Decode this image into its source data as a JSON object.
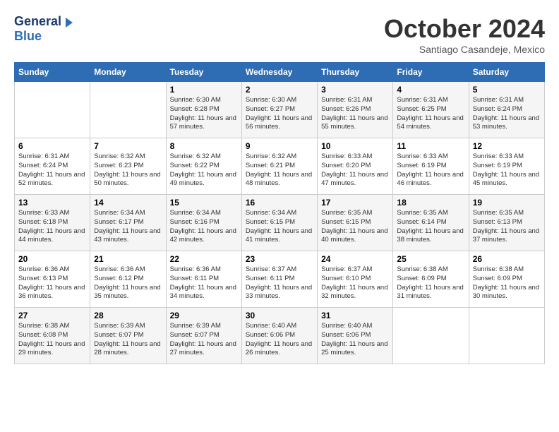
{
  "header": {
    "logo_general": "General",
    "logo_blue": "Blue",
    "month_title": "October 2024",
    "location": "Santiago Casandeje, Mexico"
  },
  "days_of_week": [
    "Sunday",
    "Monday",
    "Tuesday",
    "Wednesday",
    "Thursday",
    "Friday",
    "Saturday"
  ],
  "weeks": [
    [
      {
        "day": "",
        "info": ""
      },
      {
        "day": "",
        "info": ""
      },
      {
        "day": "1",
        "info": "Sunrise: 6:30 AM\nSunset: 6:28 PM\nDaylight: 11 hours and 57 minutes."
      },
      {
        "day": "2",
        "info": "Sunrise: 6:30 AM\nSunset: 6:27 PM\nDaylight: 11 hours and 56 minutes."
      },
      {
        "day": "3",
        "info": "Sunrise: 6:31 AM\nSunset: 6:26 PM\nDaylight: 11 hours and 55 minutes."
      },
      {
        "day": "4",
        "info": "Sunrise: 6:31 AM\nSunset: 6:25 PM\nDaylight: 11 hours and 54 minutes."
      },
      {
        "day": "5",
        "info": "Sunrise: 6:31 AM\nSunset: 6:24 PM\nDaylight: 11 hours and 53 minutes."
      }
    ],
    [
      {
        "day": "6",
        "info": "Sunrise: 6:31 AM\nSunset: 6:24 PM\nDaylight: 11 hours and 52 minutes."
      },
      {
        "day": "7",
        "info": "Sunrise: 6:32 AM\nSunset: 6:23 PM\nDaylight: 11 hours and 50 minutes."
      },
      {
        "day": "8",
        "info": "Sunrise: 6:32 AM\nSunset: 6:22 PM\nDaylight: 11 hours and 49 minutes."
      },
      {
        "day": "9",
        "info": "Sunrise: 6:32 AM\nSunset: 6:21 PM\nDaylight: 11 hours and 48 minutes."
      },
      {
        "day": "10",
        "info": "Sunrise: 6:33 AM\nSunset: 6:20 PM\nDaylight: 11 hours and 47 minutes."
      },
      {
        "day": "11",
        "info": "Sunrise: 6:33 AM\nSunset: 6:19 PM\nDaylight: 11 hours and 46 minutes."
      },
      {
        "day": "12",
        "info": "Sunrise: 6:33 AM\nSunset: 6:19 PM\nDaylight: 11 hours and 45 minutes."
      }
    ],
    [
      {
        "day": "13",
        "info": "Sunrise: 6:33 AM\nSunset: 6:18 PM\nDaylight: 11 hours and 44 minutes."
      },
      {
        "day": "14",
        "info": "Sunrise: 6:34 AM\nSunset: 6:17 PM\nDaylight: 11 hours and 43 minutes."
      },
      {
        "day": "15",
        "info": "Sunrise: 6:34 AM\nSunset: 6:16 PM\nDaylight: 11 hours and 42 minutes."
      },
      {
        "day": "16",
        "info": "Sunrise: 6:34 AM\nSunset: 6:15 PM\nDaylight: 11 hours and 41 minutes."
      },
      {
        "day": "17",
        "info": "Sunrise: 6:35 AM\nSunset: 6:15 PM\nDaylight: 11 hours and 40 minutes."
      },
      {
        "day": "18",
        "info": "Sunrise: 6:35 AM\nSunset: 6:14 PM\nDaylight: 11 hours and 38 minutes."
      },
      {
        "day": "19",
        "info": "Sunrise: 6:35 AM\nSunset: 6:13 PM\nDaylight: 11 hours and 37 minutes."
      }
    ],
    [
      {
        "day": "20",
        "info": "Sunrise: 6:36 AM\nSunset: 6:13 PM\nDaylight: 11 hours and 36 minutes."
      },
      {
        "day": "21",
        "info": "Sunrise: 6:36 AM\nSunset: 6:12 PM\nDaylight: 11 hours and 35 minutes."
      },
      {
        "day": "22",
        "info": "Sunrise: 6:36 AM\nSunset: 6:11 PM\nDaylight: 11 hours and 34 minutes."
      },
      {
        "day": "23",
        "info": "Sunrise: 6:37 AM\nSunset: 6:11 PM\nDaylight: 11 hours and 33 minutes."
      },
      {
        "day": "24",
        "info": "Sunrise: 6:37 AM\nSunset: 6:10 PM\nDaylight: 11 hours and 32 minutes."
      },
      {
        "day": "25",
        "info": "Sunrise: 6:38 AM\nSunset: 6:09 PM\nDaylight: 11 hours and 31 minutes."
      },
      {
        "day": "26",
        "info": "Sunrise: 6:38 AM\nSunset: 6:09 PM\nDaylight: 11 hours and 30 minutes."
      }
    ],
    [
      {
        "day": "27",
        "info": "Sunrise: 6:38 AM\nSunset: 6:08 PM\nDaylight: 11 hours and 29 minutes."
      },
      {
        "day": "28",
        "info": "Sunrise: 6:39 AM\nSunset: 6:07 PM\nDaylight: 11 hours and 28 minutes."
      },
      {
        "day": "29",
        "info": "Sunrise: 6:39 AM\nSunset: 6:07 PM\nDaylight: 11 hours and 27 minutes."
      },
      {
        "day": "30",
        "info": "Sunrise: 6:40 AM\nSunset: 6:06 PM\nDaylight: 11 hours and 26 minutes."
      },
      {
        "day": "31",
        "info": "Sunrise: 6:40 AM\nSunset: 6:06 PM\nDaylight: 11 hours and 25 minutes."
      },
      {
        "day": "",
        "info": ""
      },
      {
        "day": "",
        "info": ""
      }
    ]
  ]
}
